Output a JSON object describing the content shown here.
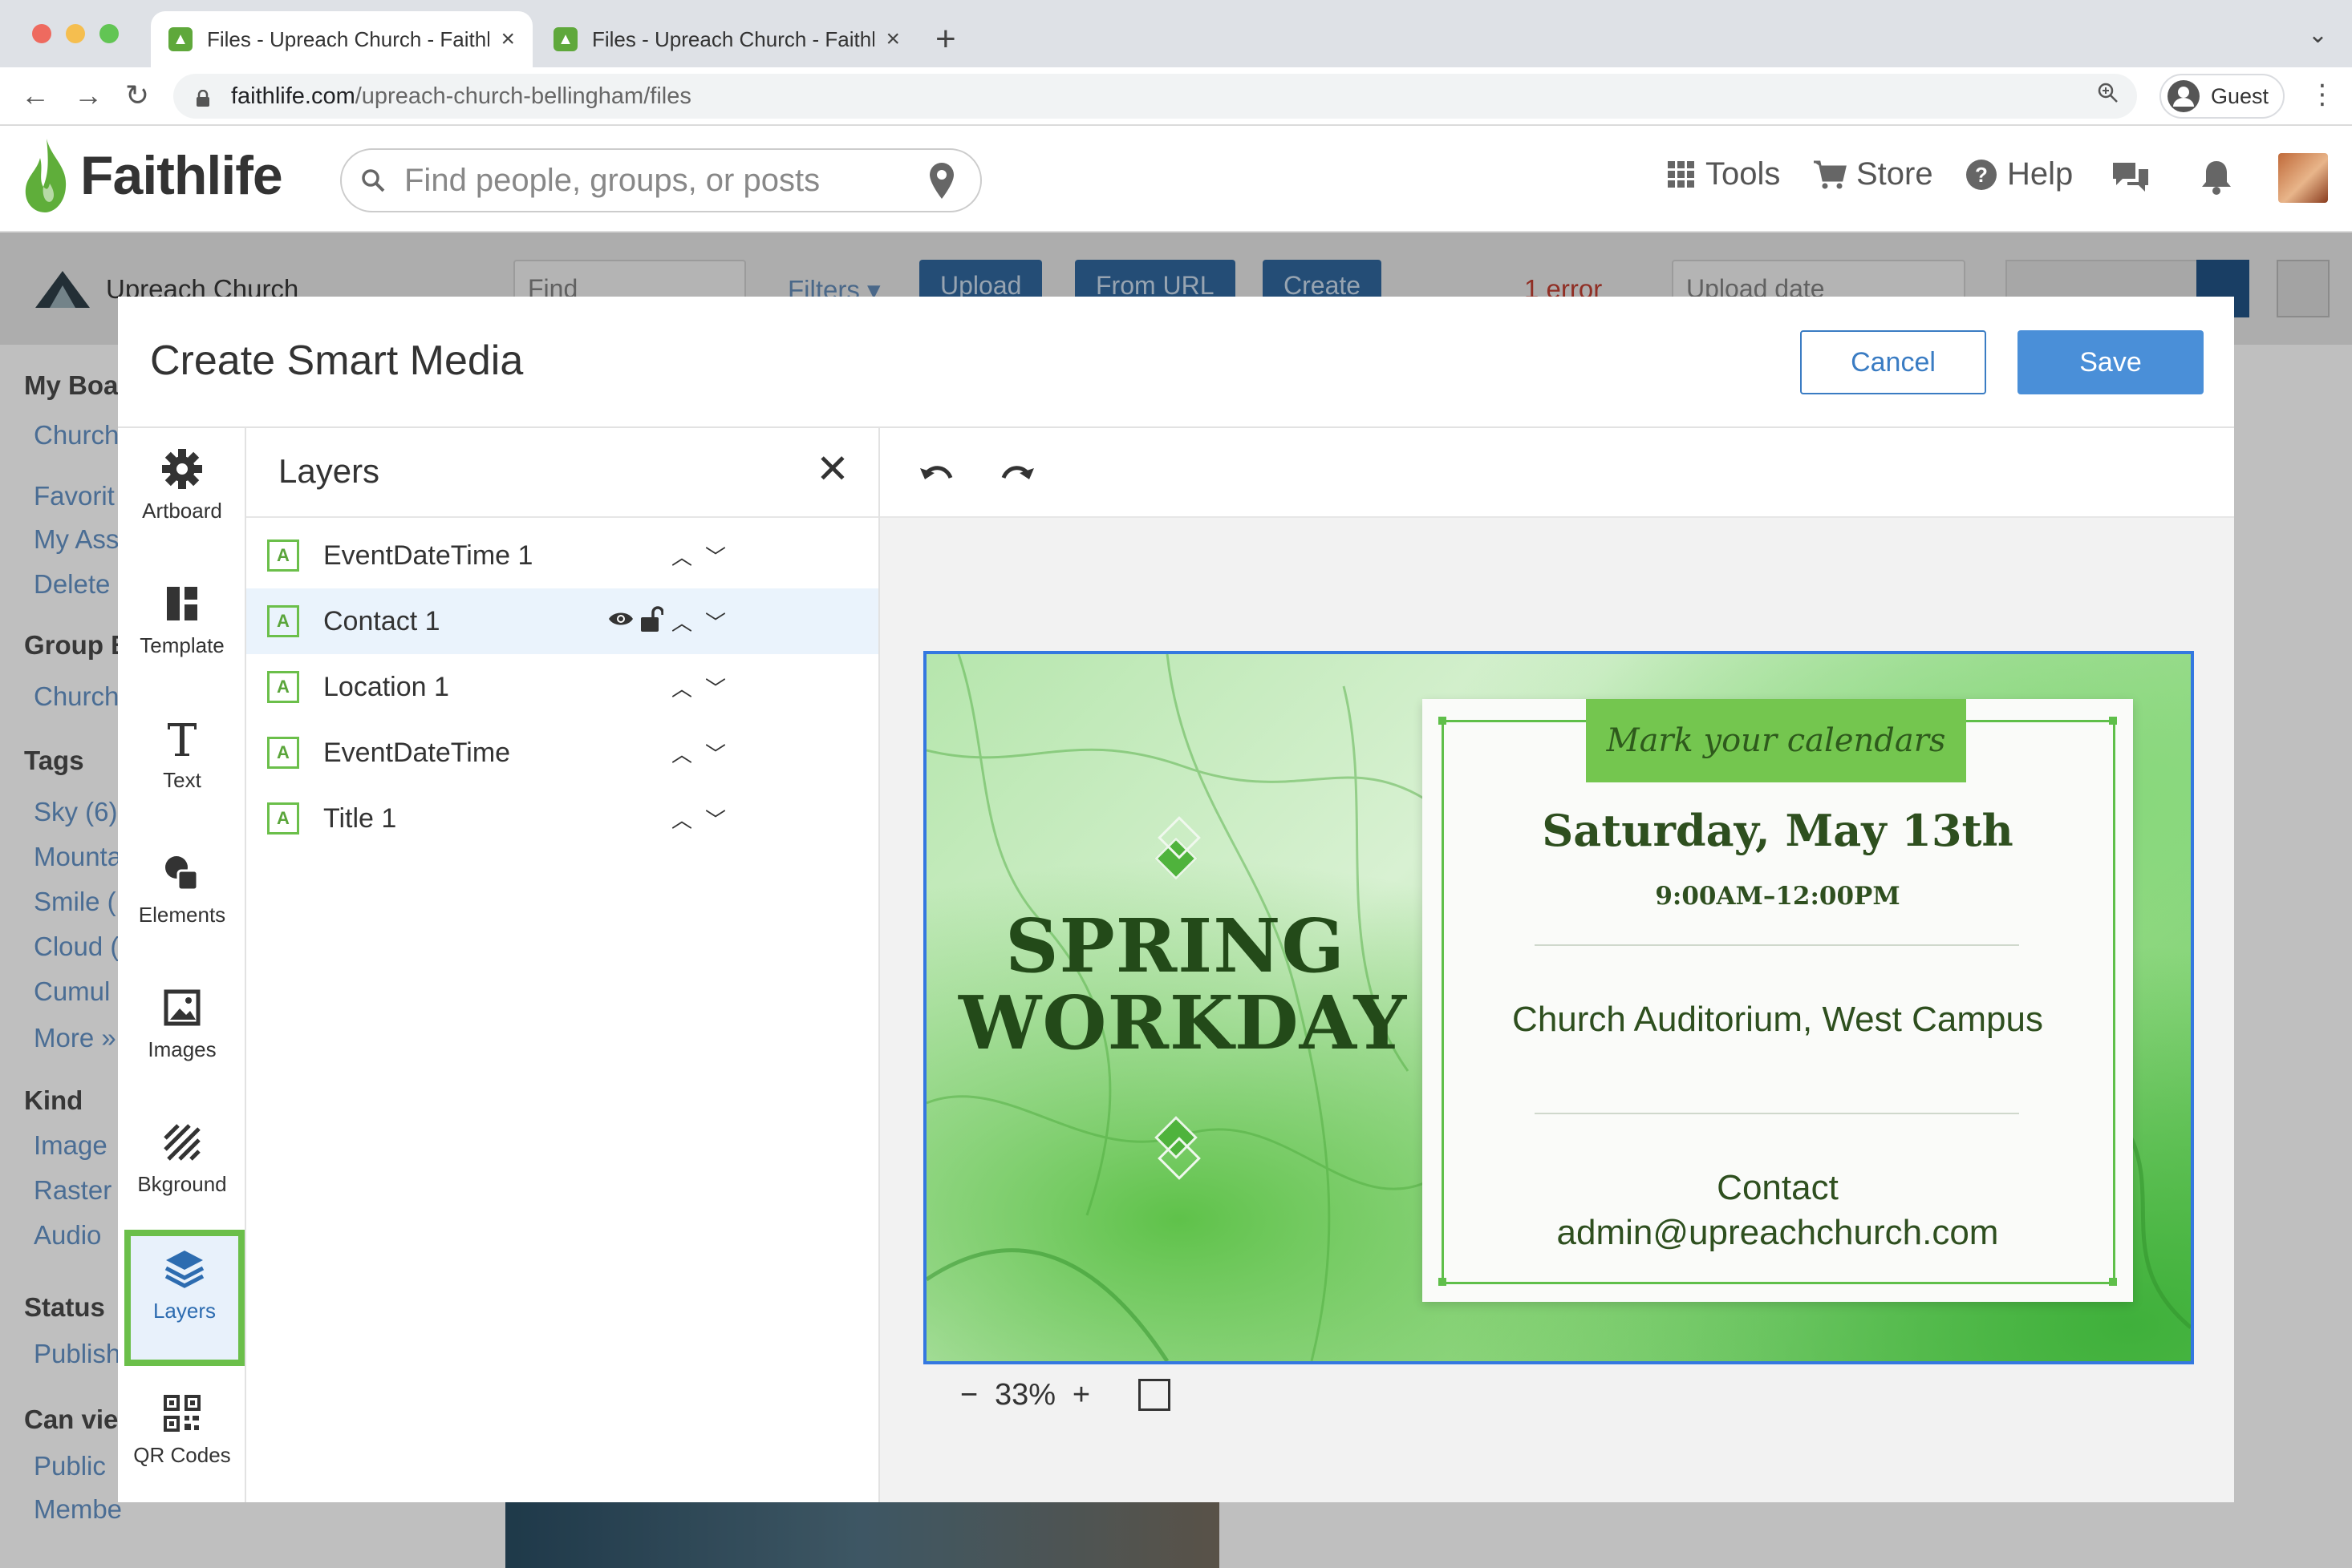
{
  "browser": {
    "tabs": [
      {
        "label": "Files - Upreach Church - Faithl",
        "active": true
      },
      {
        "label": "Files - Upreach Church - Faithl",
        "active": false
      }
    ],
    "url_host": "faithlife.com",
    "url_path": "/upreach-church-bellingham/files",
    "profile_label": "Guest"
  },
  "header": {
    "logo_text": "Faithlife",
    "search_placeholder": "Find people, groups, or posts",
    "nav": [
      {
        "label": "Tools",
        "icon": "grid-icon"
      },
      {
        "label": "Store",
        "icon": "cart-icon"
      },
      {
        "label": "Help",
        "icon": "help-icon"
      }
    ]
  },
  "background_page": {
    "group_name": "Upreach Church",
    "find_placeholder": "Find",
    "filters_label": "Filters ▾",
    "upload_label": "Upload",
    "from_url_label": "From URL",
    "create_label": "Create",
    "error_label": "1 error",
    "sort_label": "Upload date",
    "sidebar": [
      {
        "text": "My Boar",
        "kind": "heading"
      },
      {
        "text": "Church",
        "kind": "link"
      },
      {
        "text": "Favorit",
        "kind": "link"
      },
      {
        "text": "My Ass",
        "kind": "link"
      },
      {
        "text": "Delete",
        "kind": "link"
      },
      {
        "text": "Group B",
        "kind": "heading"
      },
      {
        "text": "Church",
        "kind": "link"
      },
      {
        "text": "Tags",
        "kind": "heading"
      },
      {
        "text": "Sky (6)",
        "kind": "link"
      },
      {
        "text": "Mounta",
        "kind": "link"
      },
      {
        "text": "Smile (",
        "kind": "link"
      },
      {
        "text": "Cloud (",
        "kind": "link"
      },
      {
        "text": "Cumul",
        "kind": "link"
      },
      {
        "text": "More »",
        "kind": "link"
      },
      {
        "text": "Kind",
        "kind": "heading"
      },
      {
        "text": "Image",
        "kind": "link"
      },
      {
        "text": "Raster",
        "kind": "link"
      },
      {
        "text": "Audio",
        "kind": "link"
      },
      {
        "text": "Status",
        "kind": "heading"
      },
      {
        "text": "Publish",
        "kind": "link"
      },
      {
        "text": "Can vie",
        "kind": "heading"
      },
      {
        "text": "Public",
        "kind": "link"
      },
      {
        "text": "Membe",
        "kind": "link"
      }
    ]
  },
  "modal": {
    "title": "Create Smart Media",
    "cancel_label": "Cancel",
    "save_label": "Save",
    "tools": [
      {
        "label": "Artboard",
        "icon": "gear-icon"
      },
      {
        "label": "Template",
        "icon": "template-icon"
      },
      {
        "label": "Text",
        "icon": "text-icon"
      },
      {
        "label": "Elements",
        "icon": "elements-icon"
      },
      {
        "label": "Images",
        "icon": "image-icon"
      },
      {
        "label": "Bkground",
        "icon": "background-icon"
      },
      {
        "label": "Layers",
        "icon": "layers-icon",
        "active": true
      },
      {
        "label": "QR Codes",
        "icon": "qr-code-icon"
      }
    ],
    "layers_title": "Layers",
    "layers": [
      {
        "name": "EventDateTime 1"
      },
      {
        "name": "Contact 1",
        "selected": true
      },
      {
        "name": "Location 1"
      },
      {
        "name": "EventDateTime"
      },
      {
        "name": "Title 1"
      }
    ],
    "layer_type_glyph": "A",
    "zoom": "33%"
  },
  "artboard": {
    "headline_line1": "SPRING",
    "headline_line2": "WORKDAY",
    "banner": "Mark your calendars",
    "date": "Saturday, May 13th",
    "time": "9:00AM–12:00PM",
    "location": "Church Auditorium, West Campus",
    "contact_line1": "Contact",
    "contact_line2": "admin@upreachchurch.com",
    "colors": {
      "accent": "#6bbf4a",
      "selection": "#3478e0",
      "text": "#2e4f1f"
    }
  }
}
